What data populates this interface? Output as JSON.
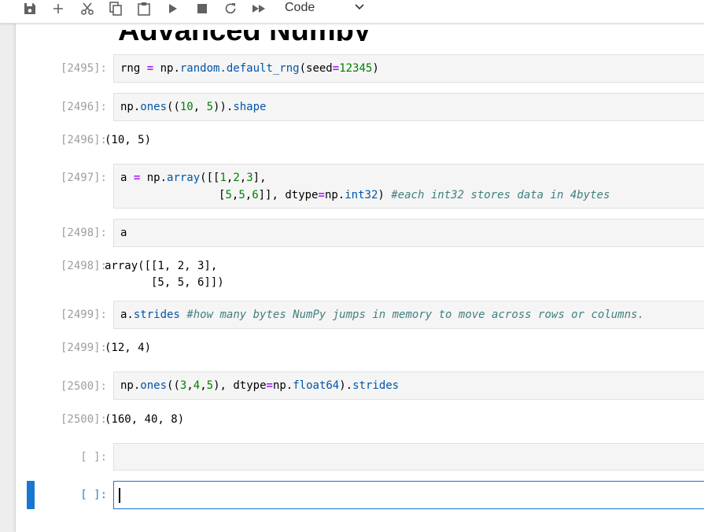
{
  "toolbar": {
    "buttons": [
      "save-icon",
      "add-cell-icon",
      "cut-icon",
      "copy-icon",
      "paste-icon",
      "run-icon",
      "stop-icon",
      "restart-icon",
      "run-all-icon"
    ],
    "cell_type": "Code"
  },
  "heading": "Advanced Numpy",
  "cells": [
    {
      "in_prompt": "[2495]:",
      "code_parts": [
        "rng ",
        "=",
        " np.",
        "random.default_rng",
        "(seed",
        "=",
        "12345",
        ")"
      ]
    },
    {
      "in_prompt": "[2496]:",
      "code_parts": [
        "np.",
        "ones",
        "((",
        "10",
        ", ",
        "5",
        ")).",
        "shape"
      ],
      "out_prompt": "[2496]:",
      "output": "(10, 5)"
    },
    {
      "in_prompt": "[2497]:",
      "line1": [
        "a ",
        "=",
        " np.",
        "array",
        "([[",
        "1",
        ",",
        "2",
        ",",
        "3",
        "],"
      ],
      "line2": [
        "[",
        "5",
        ",",
        "5",
        ",",
        "6",
        "]]",
        ", dtype",
        "=",
        "np.",
        "int32",
        ") ",
        "#each int32 stores data in 4bytes"
      ]
    },
    {
      "in_prompt": "[2498]:",
      "code": "a",
      "out_prompt": "[2498]:",
      "output_line1": "array([[1, 2, 3],",
      "output_line2": "       [5, 5, 6]])"
    },
    {
      "in_prompt": "[2499]:",
      "code_parts": [
        "a.",
        "strides",
        " ",
        "#how many bytes NumPy jumps in memory to move across rows or columns."
      ],
      "out_prompt": "[2499]:",
      "output": "(12, 4)"
    },
    {
      "in_prompt": "[2500]:",
      "code_parts": [
        "np.",
        "ones",
        "((",
        "3",
        ",",
        "4",
        ",",
        "5",
        "), dtype",
        "=",
        "np.",
        "float64",
        ").",
        "strides"
      ],
      "out_prompt": "[2500]:",
      "output": "(160, 40, 8)"
    },
    {
      "in_prompt": "[ ]:"
    },
    {
      "in_prompt": "[ ]:"
    }
  ]
}
